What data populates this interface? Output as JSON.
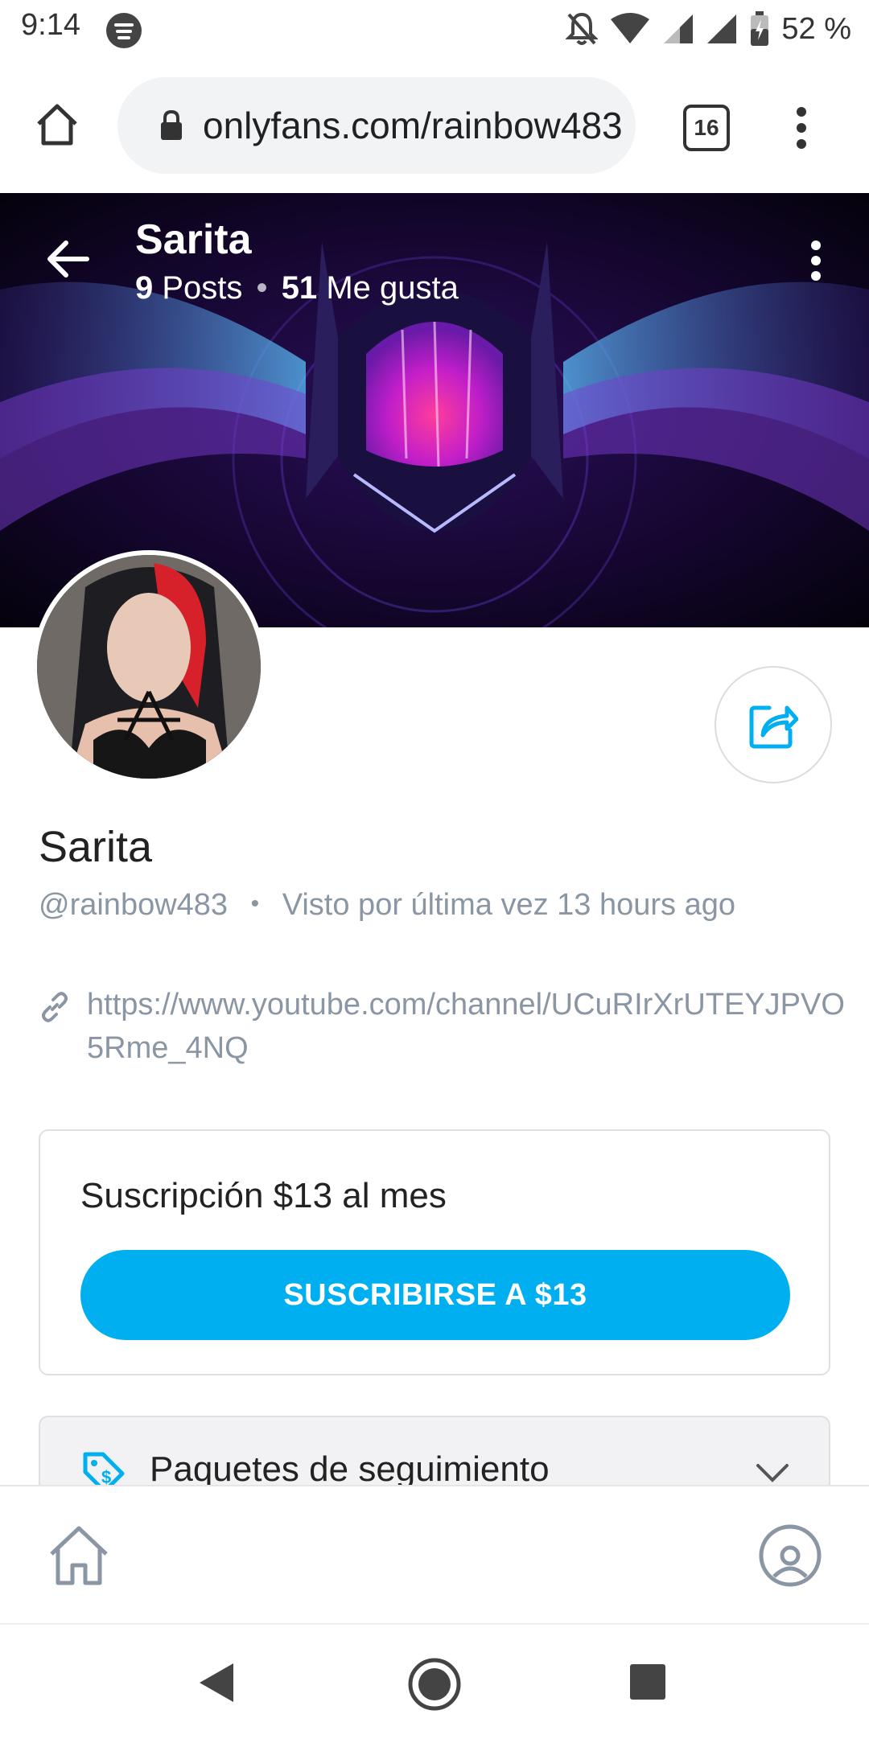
{
  "status_bar": {
    "time": "9:14",
    "battery_percent": "52 %",
    "icons": [
      "spotify-icon",
      "mute-icon",
      "wifi-icon",
      "signal-icon",
      "signal-icon-2",
      "battery-icon"
    ]
  },
  "browser": {
    "url": "onlyfans.com/rainbow483",
    "tab_count": "16",
    "icons": [
      "home-icon",
      "lock-icon",
      "menu-dots-icon"
    ]
  },
  "header": {
    "title": "Sarita",
    "posts_count": "9",
    "posts_label": "Posts",
    "likes_count": "51",
    "likes_label": "Me gusta"
  },
  "profile": {
    "name": "Sarita",
    "handle": "@rainbow483",
    "last_seen": "Visto por última vez 13 hours ago",
    "link": "https://www.youtube.com/channel/UCuRIrXrUTEYJPVO5Rme_4NQ"
  },
  "subscription": {
    "title": "Suscripción $13 al mes",
    "button_label": "SUSCRIBIRSE A $13"
  },
  "bundles": {
    "label": "Paquetes de seguimiento"
  },
  "colors": {
    "accent": "#00aff0",
    "muted_text": "#8a96a3",
    "icon_blue": "#00aff0"
  }
}
